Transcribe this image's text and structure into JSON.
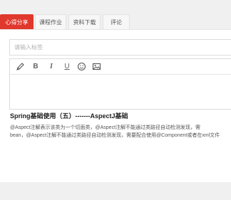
{
  "tabs": [
    {
      "label": "心得分享",
      "active": true
    },
    {
      "label": "课程作业",
      "active": false
    },
    {
      "label": "资料下载",
      "active": false
    },
    {
      "label": "评论",
      "active": false
    }
  ],
  "tag_input": {
    "placeholder": "请输入标签"
  },
  "toolbar": {
    "buttons": [
      {
        "name": "pencil-icon"
      },
      {
        "name": "bold-icon",
        "glyph": "B"
      },
      {
        "name": "italic-icon",
        "glyph": "I"
      },
      {
        "name": "underline-icon",
        "glyph": "U"
      },
      {
        "name": "emoji-icon"
      },
      {
        "name": "image-icon"
      }
    ]
  },
  "article": {
    "title": "Spring基础使用（五）-------AspectJ基础",
    "body_line1": "@Aspect注解表示该类为一个切面类，@Aspect注解不能通过类路径自动检测发现，需",
    "body_line2": "bean，@Aspect注解不能通过类路径自动检测发现，需要配合使用@Component或者在xml文件"
  },
  "colors": {
    "accent": "#e1382d",
    "border": "#dcdcdc",
    "background": "#f0f0f0"
  }
}
